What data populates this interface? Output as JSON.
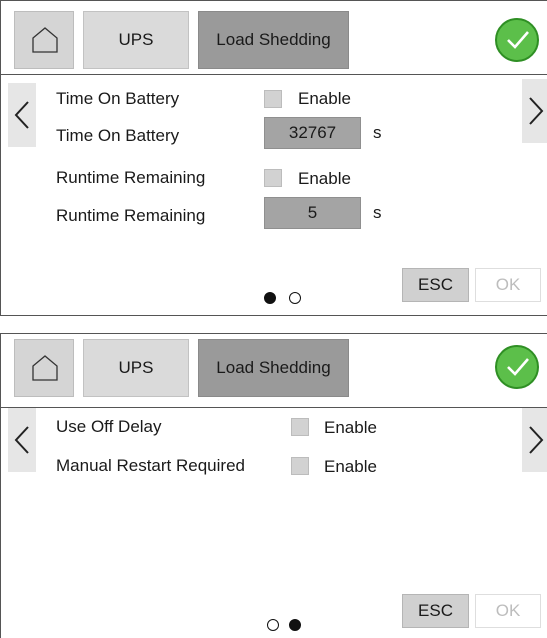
{
  "colors": {
    "accent_check": "#5cbf4a",
    "active_tab": "#9a9a9a"
  },
  "panels": [
    {
      "header": {
        "home_icon": "home-icon",
        "tab_ups": "UPS",
        "tab_load_shedding": "Load Shedding",
        "confirm_icon": "check-icon"
      },
      "rows": [
        {
          "label": "Time On Battery",
          "checkbox_label": "Enable",
          "checked": false
        },
        {
          "label": "Time On Battery",
          "value": "32767",
          "unit": "s"
        },
        {
          "label": "Runtime Remaining",
          "checkbox_label": "Enable",
          "checked": false
        },
        {
          "label": "Runtime Remaining",
          "value": "5",
          "unit": "s"
        }
      ],
      "page_indicator": {
        "current": 1,
        "total": 2
      },
      "buttons": {
        "esc": "ESC",
        "ok": "OK"
      }
    },
    {
      "header": {
        "home_icon": "home-icon",
        "tab_ups": "UPS",
        "tab_load_shedding": "Load Shedding",
        "confirm_icon": "check-icon"
      },
      "rows": [
        {
          "label": "Use Off Delay",
          "checkbox_label": "Enable",
          "checked": false
        },
        {
          "label": "Manual Restart Required",
          "checkbox_label": "Enable",
          "checked": false
        }
      ],
      "page_indicator": {
        "current": 2,
        "total": 2
      },
      "buttons": {
        "esc": "ESC",
        "ok": "OK"
      }
    }
  ]
}
